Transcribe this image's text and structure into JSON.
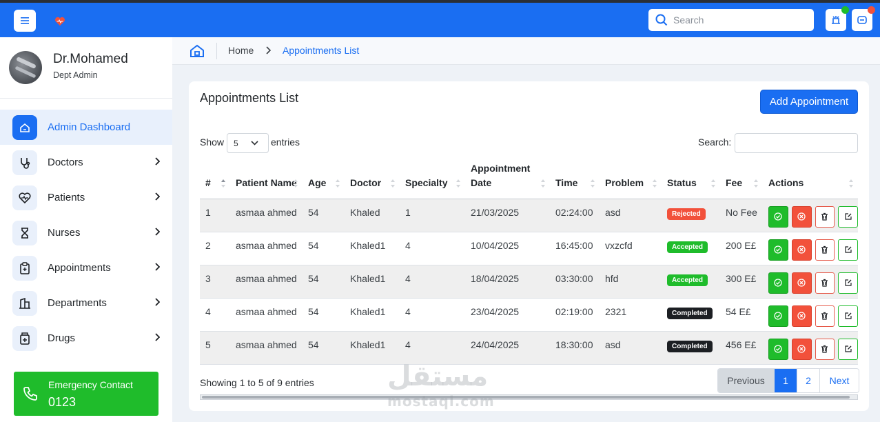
{
  "topbar": {
    "search_placeholder": "Search",
    "notif_dot_color": "#1fbc2b",
    "chat_dot_color": "#f2513b",
    "icons": [
      "menu-icon",
      "heart-logo-icon",
      "search-icon",
      "notification-icon",
      "chat-icon"
    ]
  },
  "profile": {
    "name": "Dr.Mohamed",
    "role": "Dept Admin"
  },
  "sidebar": {
    "items": [
      {
        "label": "Admin Dashboard",
        "icon": "home-icon",
        "active": true
      },
      {
        "label": "Doctors",
        "icon": "stethoscope-icon"
      },
      {
        "label": "Patients",
        "icon": "heart-pulse-icon"
      },
      {
        "label": "Nurses",
        "icon": "hourglass-icon"
      },
      {
        "label": "Appointments",
        "icon": "clipboard-icon"
      },
      {
        "label": "Departments",
        "icon": "building-icon"
      },
      {
        "label": "Drugs",
        "icon": "medicine-icon"
      }
    ],
    "emergency_label": "Emergency Contact",
    "emergency_number": "0123"
  },
  "breadcrumb": {
    "home": "Home",
    "current": "Appointments List"
  },
  "card": {
    "title": "Appointments List",
    "add_button": "Add Appointment",
    "show_label": "Show",
    "show_value": "5",
    "entries_label": "entries",
    "search_label": "Search:"
  },
  "table": {
    "headers": [
      "#",
      "Patient Name",
      "Age",
      "Doctor",
      "Specialty",
      "Appointment Date",
      "Time",
      "Problem",
      "Status",
      "Fee",
      "Actions"
    ],
    "rows": [
      {
        "num": "1",
        "patient": "asmaa ahmed",
        "age": "54",
        "doctor": "Khaled",
        "specialty": "1",
        "date": "21/03/2025",
        "time": "02:24:00",
        "problem": "asd",
        "status": "Rejected",
        "fee": "No Fee"
      },
      {
        "num": "2",
        "patient": "asmaa ahmed",
        "age": "54",
        "doctor": "Khaled1",
        "specialty": "4",
        "date": "10/04/2025",
        "time": "16:45:00",
        "problem": "vxzcfd",
        "status": "Accepted",
        "fee": "200 E£"
      },
      {
        "num": "3",
        "patient": "asmaa ahmed",
        "age": "54",
        "doctor": "Khaled1",
        "specialty": "4",
        "date": "18/04/2025",
        "time": "03:30:00",
        "problem": "hfd",
        "status": "Accepted",
        "fee": "300 E£"
      },
      {
        "num": "4",
        "patient": "asmaa ahmed",
        "age": "54",
        "doctor": "Khaled1",
        "specialty": "4",
        "date": "23/04/2025",
        "time": "02:19:00",
        "problem": "2321",
        "status": "Completed",
        "fee": "54 E£"
      },
      {
        "num": "5",
        "patient": "asmaa ahmed",
        "age": "54",
        "doctor": "Khaled1",
        "specialty": "4",
        "date": "24/04/2025",
        "time": "18:30:00",
        "problem": "asd",
        "status": "Completed",
        "fee": "456 E£"
      }
    ]
  },
  "footer": {
    "showing": "Showing 1 to 5 of 9 entries",
    "previous": "Previous",
    "pages": [
      "1",
      "2"
    ],
    "current_page": "1",
    "next": "Next"
  },
  "watermark": {
    "arabic": "مستقل",
    "latin": "mostaql.com"
  },
  "colors": {
    "primary": "#1a6ef2",
    "success": "#1fbc2b",
    "danger": "#f2513b",
    "dark": "#1c1f23"
  }
}
